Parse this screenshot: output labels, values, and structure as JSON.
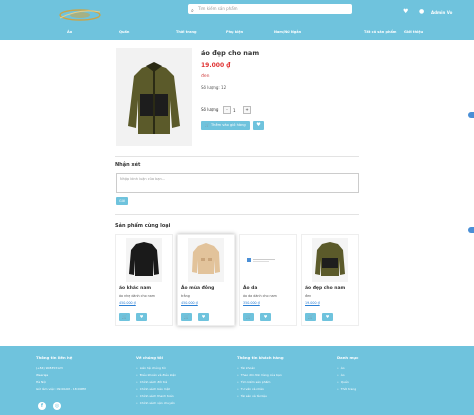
{
  "header": {
    "search_placeholder": "Tìm kiếm sản phẩm",
    "user_name": "Admin Vo"
  },
  "nav": [
    "Áo",
    "Quần",
    "Thời trang",
    "Phụ kiện",
    "Nam/Nữ Ngắn",
    "Tất cả sản phẩm",
    "Giới thiệu"
  ],
  "product": {
    "title": "áo đẹp cho nam",
    "price": "19.000 ₫",
    "color": "đen",
    "stock": "Số lượng: 12",
    "qty_label": "Số lượng",
    "minus": "-",
    "qty": "1",
    "plus": "+",
    "add_to_cart": "🛒 Thêm vào giỏ hàng"
  },
  "comments": {
    "heading": "Nhận xét",
    "placeholder": "Nhập bình luận của bạn...",
    "send": "Gửi"
  },
  "related": {
    "heading": "Sản phẩm cùng loại",
    "items": [
      {
        "name": "áo khác nam",
        "desc": "áo nhẹ dành cho nam",
        "price": "450.000 ₫",
        "kind": "black-jacket"
      },
      {
        "name": "Áo mùa đông",
        "desc": "trắng",
        "price": "450.000 ₫",
        "kind": "beige-jacket"
      },
      {
        "name": "Áo da",
        "desc": "áo da dành cho nam",
        "price": "350.000 ₫",
        "kind": "placeholder"
      },
      {
        "name": "áo đẹp cho nam",
        "desc": "đen",
        "price": "19.000 ₫",
        "kind": "olive-jacket"
      }
    ]
  },
  "footer": {
    "col1": {
      "title": "Thông tin liên hệ",
      "lines": [
        "(+84) 908353123",
        "Weeraje",
        "Hà Nội",
        "Giờ làm việc: 09:00AM - 18:00PM"
      ]
    },
    "col2": {
      "title": "Về chúng tôi",
      "lines": [
        "Liên hệ chúng tôi",
        "Điều khoản và điều kiện",
        "Chính sách đổi trả",
        "Chính sách bảo mật",
        "Chính sách thanh toán",
        "Chính sách vận chuyển"
      ]
    },
    "col3": {
      "title": "Thông tin khách hàng",
      "lines": [
        "Tài khoản",
        "Theo dõi đơn hàng của bạn",
        "Tìm kiếm sản phẩm",
        "Tư vấn cá nhân",
        "Tài sản và tài liệu"
      ]
    },
    "col4": {
      "title": "Danh mục",
      "lines": [
        "Áo",
        "Áo",
        "Quần",
        "Thời trang"
      ]
    }
  }
}
